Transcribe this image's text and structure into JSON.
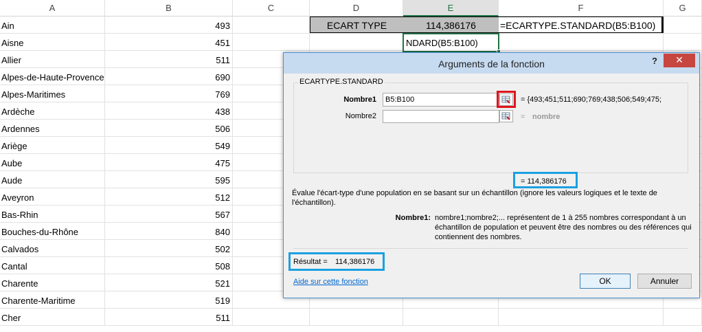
{
  "columns": [
    "A",
    "B",
    "C",
    "D",
    "E",
    "F",
    "G"
  ],
  "rows": [
    {
      "name": "Ain",
      "value": "493"
    },
    {
      "name": "Aisne",
      "value": "451"
    },
    {
      "name": "Allier",
      "value": "511"
    },
    {
      "name": "Alpes-de-Haute-Provence",
      "value": "690"
    },
    {
      "name": "Alpes-Maritimes",
      "value": "769"
    },
    {
      "name": "Ardèche",
      "value": "438"
    },
    {
      "name": "Ardennes",
      "value": "506"
    },
    {
      "name": "Ariège",
      "value": "549"
    },
    {
      "name": "Aube",
      "value": "475"
    },
    {
      "name": "Aude",
      "value": "595"
    },
    {
      "name": "Aveyron",
      "value": "512"
    },
    {
      "name": "Bas-Rhin",
      "value": "567"
    },
    {
      "name": "Bouches-du-Rhône",
      "value": "840"
    },
    {
      "name": "Calvados",
      "value": "502"
    },
    {
      "name": "Cantal",
      "value": "508"
    },
    {
      "name": "Charente",
      "value": "521"
    },
    {
      "name": "Charente-Maritime",
      "value": "519"
    },
    {
      "name": "Cher",
      "value": "511"
    }
  ],
  "cells": {
    "d1": "ECART TYPE",
    "e1": "114,386176",
    "f1": "=ECARTYPE.STANDARD(B5:B100)",
    "e2": "NDARD(B5:B100)"
  },
  "dialog": {
    "title": "Arguments de la fonction",
    "help": "?",
    "close": "✕",
    "function_name": "ECARTYPE.STANDARD",
    "arg1_label": "Nombre1",
    "arg1_value": "B5:B100",
    "arg1_result": "= {493;451;511;690;769;438;506;549;475;",
    "arg2_label": "Nombre2",
    "arg2_value": "",
    "arg2_result_eq": "=",
    "arg2_result": "nombre",
    "formula_result": "=  114,386176",
    "description": "Évalue l'écart-type d'une population en se basant sur un échantillon (ignore les valeurs logiques et le texte de l'échantillon).",
    "arg_help_label": "Nombre1:",
    "arg_help_text": "nombre1;nombre2;... représentent de 1 à 255 nombres correspondant à un échantillon de population et peuvent être des nombres ou des références qui contiennent des nombres.",
    "result_label": "Résultat =",
    "result_value": "114,386176",
    "help_link": "Aide sur cette fonction",
    "ok": "OK",
    "cancel": "Annuler"
  },
  "colors": {
    "accent_green": "#217346",
    "highlight_blue": "#1aa0e0",
    "highlight_red": "#e0141e",
    "header_gray": "#bfbfbf"
  }
}
